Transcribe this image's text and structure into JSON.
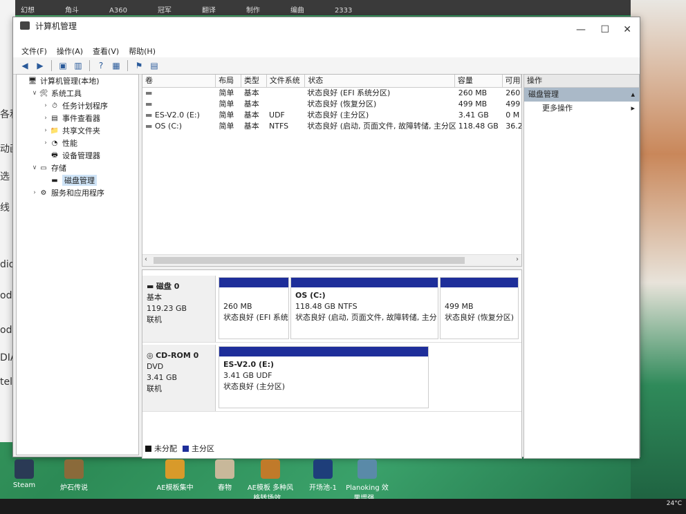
{
  "desktop": {
    "top_items": [
      "幻想",
      "角斗",
      "A360",
      "冠军",
      "翻译",
      "制作",
      "编曲",
      "2333"
    ],
    "side_text": [
      "各和",
      "动画",
      "选",
      "线",
      "dio",
      "ode",
      "ode",
      "DIA",
      "tel"
    ],
    "icons": [
      {
        "label": "Steam"
      },
      {
        "label": "炉石传说"
      },
      {
        "label": "AE模板集中"
      },
      {
        "label": "春物"
      },
      {
        "label": "AE模板 多种风格转场效..."
      },
      {
        "label": "开场池-1"
      },
      {
        "label": "Planoking 效果增强..."
      }
    ],
    "clock": "24°C"
  },
  "window": {
    "title": "计算机管理",
    "controls": {
      "minimize": "—",
      "maximize": "☐",
      "close": "✕"
    },
    "menu": [
      "文件(F)",
      "操作(A)",
      "查看(V)",
      "帮助(H)"
    ]
  },
  "tree": [
    {
      "label": "计算机管理(本地)",
      "level": 0,
      "arrow": "",
      "icon": "computer-icon",
      "glyph": "🖥"
    },
    {
      "label": "系统工具",
      "level": 1,
      "arrow": "∨",
      "icon": "tools-icon",
      "glyph": "🛠"
    },
    {
      "label": "任务计划程序",
      "level": 2,
      "arrow": "›",
      "icon": "task-scheduler-icon",
      "glyph": "⏱"
    },
    {
      "label": "事件查看器",
      "level": 2,
      "arrow": "›",
      "icon": "event-viewer-icon",
      "glyph": "▤"
    },
    {
      "label": "共享文件夹",
      "level": 2,
      "arrow": "›",
      "icon": "shared-folder-icon",
      "glyph": "📁"
    },
    {
      "label": "性能",
      "level": 2,
      "arrow": "›",
      "icon": "performance-icon",
      "glyph": "◔"
    },
    {
      "label": "设备管理器",
      "level": 2,
      "arrow": "",
      "icon": "device-manager-icon",
      "glyph": "🖶"
    },
    {
      "label": "存储",
      "level": 1,
      "arrow": "∨",
      "icon": "storage-icon",
      "glyph": "▭"
    },
    {
      "label": "磁盘管理",
      "level": 2,
      "arrow": "",
      "icon": "disk-management-icon",
      "glyph": "▬",
      "selected": true
    },
    {
      "label": "服务和应用程序",
      "level": 1,
      "arrow": "›",
      "icon": "services-icon",
      "glyph": "⚙"
    }
  ],
  "volumes": {
    "columns": [
      "卷",
      "布局",
      "类型",
      "文件系统",
      "状态",
      "容量",
      "可用"
    ],
    "rows": [
      {
        "name": "",
        "layout": "简单",
        "type": "基本",
        "fs": "",
        "status": "状态良好 (EFI 系统分区)",
        "capacity": "260 MB",
        "free": "260"
      },
      {
        "name": "",
        "layout": "简单",
        "type": "基本",
        "fs": "",
        "status": "状态良好 (恢复分区)",
        "capacity": "499 MB",
        "free": "499"
      },
      {
        "name": "ES-V2.0 (E:)",
        "layout": "简单",
        "type": "基本",
        "fs": "UDF",
        "status": "状态良好 (主分区)",
        "capacity": "3.41 GB",
        "free": "0 M"
      },
      {
        "name": "OS (C:)",
        "layout": "简单",
        "type": "基本",
        "fs": "NTFS",
        "status": "状态良好 (启动, 页面文件, 故障转储, 主分区)",
        "capacity": "118.48 GB",
        "free": "36.2"
      }
    ]
  },
  "disks": [
    {
      "name": "磁盘 0",
      "type": "基本",
      "size": "119.23 GB",
      "state": "联机",
      "partitions": [
        {
          "name": "",
          "size": "260 MB",
          "status": "状态良好 (EFI 系统"
        },
        {
          "name": "OS  (C:)",
          "size": "118.48 GB NTFS",
          "status": "状态良好 (启动, 页面文件, 故障转储, 主分"
        },
        {
          "name": "",
          "size": "499 MB",
          "status": "状态良好 (恢复分区)"
        }
      ]
    },
    {
      "name": "CD-ROM 0",
      "type": "DVD",
      "size": "3.41 GB",
      "state": "联机",
      "partitions": [
        {
          "name": "ES-V2.0  (E:)",
          "size": "3.41 GB UDF",
          "status": "状态良好 (主分区)"
        }
      ]
    }
  ],
  "legend": [
    {
      "label": "未分配",
      "color": "#111111"
    },
    {
      "label": "主分区",
      "color": "#1e2e9a"
    }
  ],
  "actions": {
    "header": "操作",
    "section": "磁盘管理",
    "items": [
      "更多操作"
    ]
  }
}
